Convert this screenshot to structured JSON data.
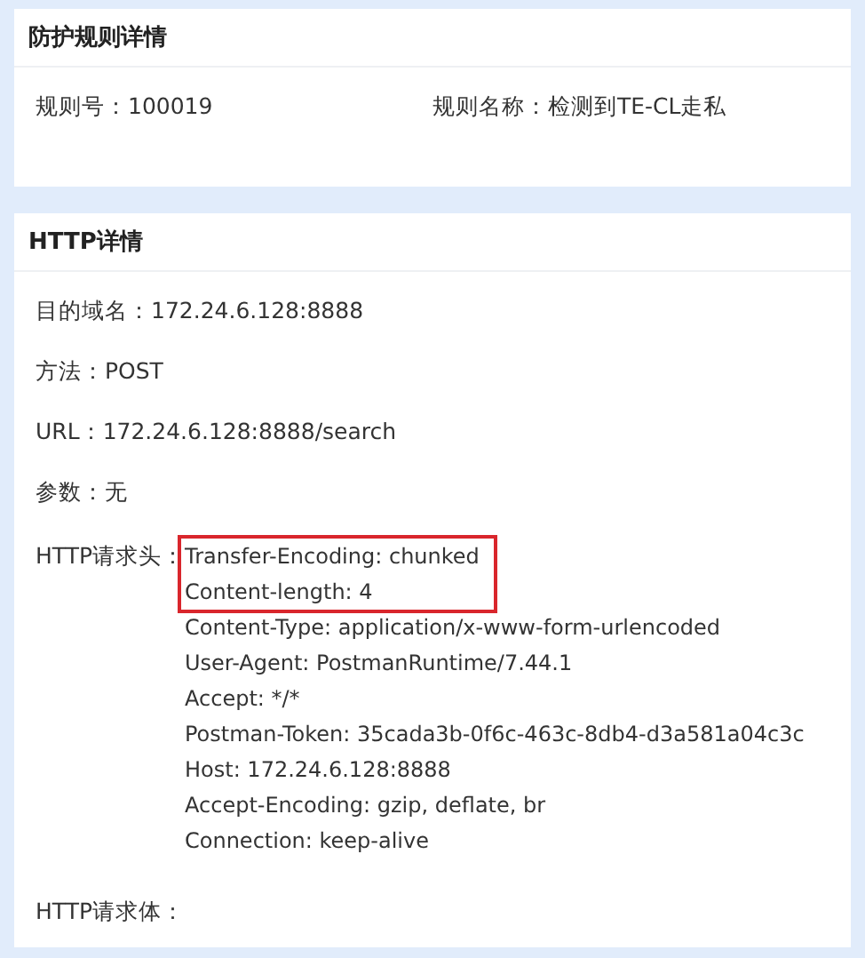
{
  "rule_card": {
    "title": "防护规则详情",
    "fields": [
      {
        "label": "规则号：",
        "value": "100019"
      },
      {
        "label": "规则名称：",
        "value": "检测到TE-CL走私"
      }
    ]
  },
  "http_card": {
    "title": "HTTP详情",
    "fields": [
      {
        "label": "目的域名：",
        "value": "172.24.6.128:8888"
      },
      {
        "label": "方法：",
        "value": "POST"
      },
      {
        "label": "URL：",
        "value": "172.24.6.128:8888/search"
      },
      {
        "label": "参数：",
        "value": "无"
      }
    ],
    "request_headers": {
      "label": "HTTP请求头：",
      "lines": [
        {
          "text": "Transfer-Encoding: chunked",
          "highlighted": true
        },
        {
          "text": "Content-length: 4",
          "highlighted": true
        },
        {
          "text": "Content-Type: application/x-www-form-urlencoded",
          "highlighted": false
        },
        {
          "text": "User-Agent: PostmanRuntime/7.44.1",
          "highlighted": false
        },
        {
          "text": "Accept: */*",
          "highlighted": false
        },
        {
          "text": "Postman-Token: 35cada3b-0f6c-463c-8db4-d3a581a04c3c",
          "highlighted": false
        },
        {
          "text": "Host: 172.24.6.128:8888",
          "highlighted": false
        },
        {
          "text": "Accept-Encoding: gzip, deflate, br",
          "highlighted": false
        },
        {
          "text": "Connection: keep-alive",
          "highlighted": false
        }
      ]
    },
    "request_body": {
      "label": "HTTP请求体："
    }
  }
}
